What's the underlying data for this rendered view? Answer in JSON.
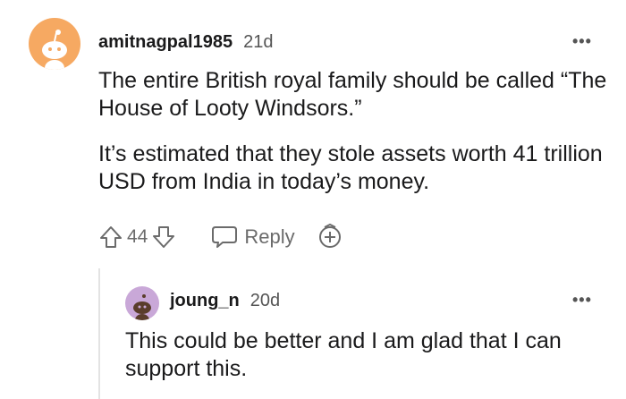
{
  "comment": {
    "username": "amitnagpal1985",
    "time": "21d",
    "paragraph1": "The entire British royal family should be called “The House of Looty Windsors.”",
    "paragraph2": "It’s estimated that they stole assets worth 41 trillion USD from India in today’s money.",
    "upvotes": "44",
    "reply_label": "Reply",
    "more_icon": "ellipsis-icon"
  },
  "reply": {
    "username": "joung_n",
    "time": "20d",
    "text": "This could be better and I am glad that I can support this.",
    "more_icon": "ellipsis-icon"
  },
  "colors": {
    "avatar_main": "#f6a962",
    "avatar_reply": "#c9a8d8",
    "icon_gray": "#6b6b6b"
  }
}
